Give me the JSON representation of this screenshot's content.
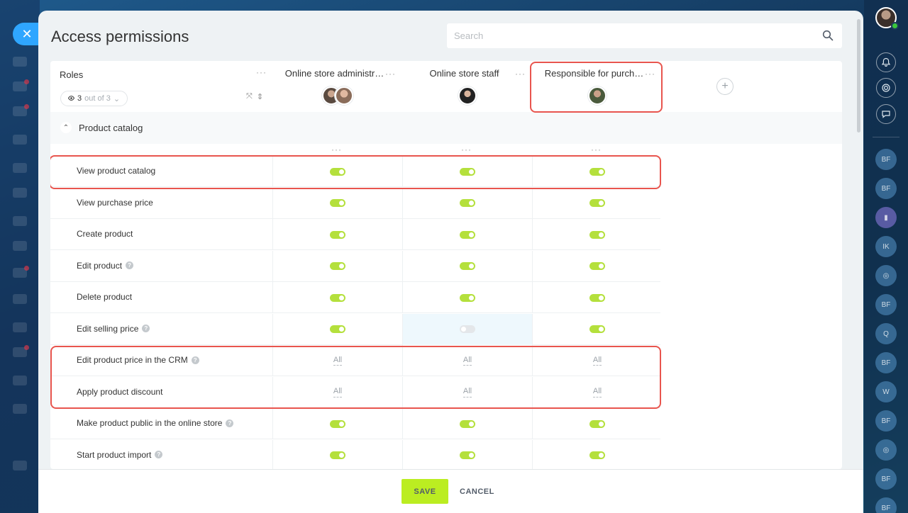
{
  "modal": {
    "title": "Access permissions"
  },
  "search": {
    "placeholder": "Search"
  },
  "roles_header": {
    "label": "Roles",
    "filter_count": "3",
    "filter_of": "out of 3"
  },
  "columns": [
    {
      "title": "Online store administr…"
    },
    {
      "title": "Online store staff"
    },
    {
      "title": "Responsible for purch…"
    }
  ],
  "section": {
    "label": "Product catalog"
  },
  "rows": [
    {
      "label": "View product catalog",
      "help": false
    },
    {
      "label": "View purchase price",
      "help": false
    },
    {
      "label": "Create product",
      "help": false
    },
    {
      "label": "Edit product",
      "help": true
    },
    {
      "label": "Delete product",
      "help": false
    },
    {
      "label": "Edit selling price",
      "help": true
    },
    {
      "label": "Edit product price in the CRM",
      "help": true
    },
    {
      "label": "Apply product discount",
      "help": false
    },
    {
      "label": "Make product public in the online store",
      "help": true
    },
    {
      "label": "Start product import",
      "help": true
    }
  ],
  "cell_values": {
    "all": "All"
  },
  "footer": {
    "save": "SAVE",
    "cancel": "CANCEL"
  },
  "right_rail": {
    "bubbles": [
      "BF",
      "BF",
      "",
      "IK",
      "",
      "BF",
      "Q",
      "BF",
      "W",
      "BF",
      "",
      "BF",
      "BF"
    ]
  },
  "colors": {
    "toggle_on": "#b4e03c",
    "highlight": "#e8554e",
    "save": "#bbed21",
    "accent": "#2fa6ff"
  }
}
